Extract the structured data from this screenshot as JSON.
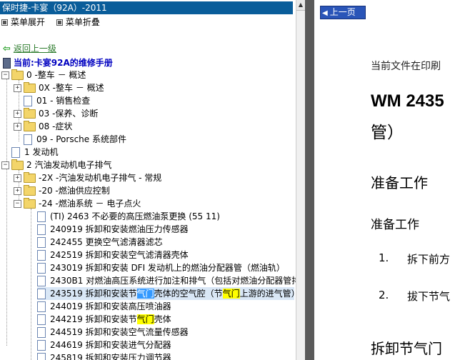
{
  "title": "保时捷-卡宴（92A）-2011",
  "menu": {
    "expand": "菜单展开",
    "collapse": "菜单折叠"
  },
  "back_label": "返回上一级",
  "current_label": "当前:卡宴92A的维修手册",
  "tree": {
    "r0": "0 -整车 － 概述",
    "r1": "0X -整车 － 概述",
    "r2": "01 - 销售检查",
    "r3": "03 -保养、诊断",
    "r4": "08 -症状",
    "r5": "09 - Porsche 系统部件",
    "r6": "1 发动机",
    "r7": "2 汽油发动机电子排气",
    "r8": "-2X -汽油发动机电子排气 - 常规",
    "r9": "-20 -燃油供应控制",
    "r10": "-24 -燃油系统 － 电子点火",
    "r11": "(TI) 2463 不必要的高压燃油泵更换 (55 11)",
    "r12": "240919 拆卸和安装燃油压力传感器",
    "r13": "242455 更换空气滤清器滤芯",
    "r14": "242519 拆卸和安装空气滤清器壳体",
    "r15": "243019 拆卸和安装 DFI 发动机上的燃油分配器管（燃油轨）",
    "r16": "2430B1 对燃油高压系统进行加注和排气（包括对燃油分配器管排",
    "r17_a": "243519 拆卸和安装节",
    "r17_b": "气门",
    "r17_c": "壳体的空气腔（节",
    "r17_d": "气门",
    "r17_e": "上游的进气管）",
    "r18": "244019 拆卸和安装高压喷油器",
    "r19_a": "244219 拆卸和安装节",
    "r19_b": "气门",
    "r19_c": "壳体",
    "r20": "244519 拆卸和安装空气流量传感器",
    "r21": "244619 拆卸和安装进气分配器",
    "r22": "245819 拆卸和安装压力调节器"
  },
  "right": {
    "prev": "上一页",
    "intro": "当前文件在印刷",
    "heading1": "WM 2435",
    "heading2": "管）",
    "sec1": "准备工作",
    "sec2": "准备工作",
    "n1": "1.",
    "s1": "拆下前方",
    "n2": "2.",
    "s2": "拔下节气",
    "sec3": "拆卸节气门"
  }
}
